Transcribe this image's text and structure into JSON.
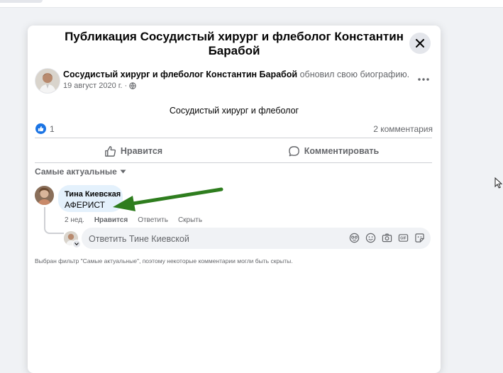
{
  "modal": {
    "title": "Публикация Сосудистый хирург и флеболог Константин Барабой"
  },
  "post": {
    "author": "Сосудистый хирург и флеболог Константин Барабой",
    "action": "обновил свою биографию.",
    "date": "19 август 2020 г. ·",
    "text": "Сосудистый хирург и флеболог",
    "like_count": "1",
    "comments_count": "2 комментария"
  },
  "actions": {
    "like_label": "Нравится",
    "comment_label": "Комментировать"
  },
  "comments": {
    "sort_label": "Самые актуальные",
    "items": [
      {
        "author": "Тина Киевская",
        "text": "АФЕРИСТ",
        "time": "2 нед.",
        "like_label": "Нравится",
        "reply_label": "Ответить",
        "hide_label": "Скрыть"
      }
    ],
    "reply_placeholder": "Ответить Тине Киевской",
    "filter_note": "Выбран фильтр \"Самые актуальные\", поэтому некоторые комментарии могли быть скрыты."
  },
  "annotation": {
    "arrow_color": "#2e7d1e"
  },
  "colors": {
    "accent": "#1b74e4",
    "bubble": "#e4f1fc",
    "secondary_text": "#65676b"
  },
  "icons": [
    "close-icon",
    "more-icon",
    "globe-icon",
    "like-icon",
    "thumbs-up-icon",
    "comment-icon",
    "caret-down-icon",
    "avatar-icon",
    "sticker-icon",
    "emoji-icon",
    "camera-icon",
    "gif-icon",
    "sticker-alt-icon"
  ]
}
